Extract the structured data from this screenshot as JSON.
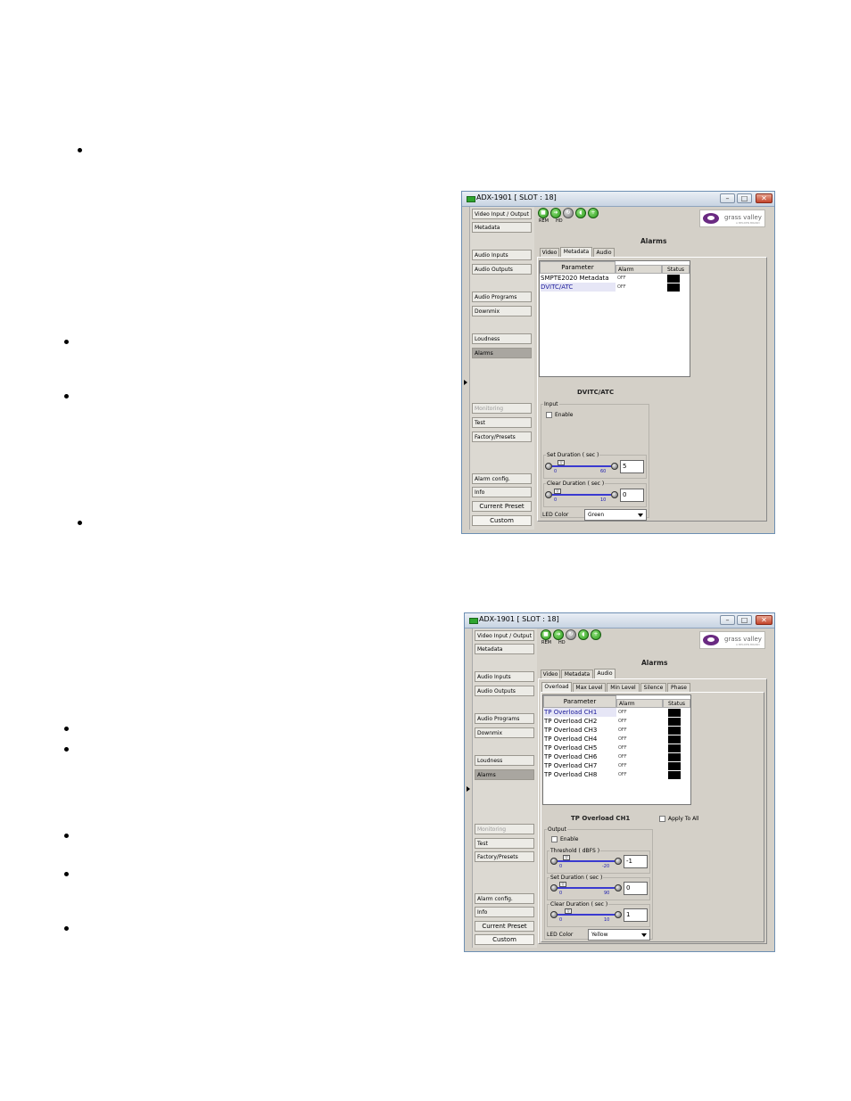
{
  "colors": {
    "title_bar": "#c8d4e2",
    "app_icon": "#2fa52f",
    "status_black": "#000000",
    "logo_purple": "#6a2a82",
    "slider_blue": "#3a3ad0"
  },
  "window1": {
    "title": "ADX-1901 [ SLOT : 18]",
    "win_buttons": {
      "minimize": "–",
      "maximize": "□",
      "close": "✕"
    },
    "toolbar": {
      "rem": "REM",
      "hd": "HD"
    },
    "logo": {
      "name": "grass valley",
      "tagline": "A BELDEN BRAND"
    },
    "nav": [
      "Video Input / Output",
      "Metadata",
      "Audio Inputs",
      "Audio Outputs",
      "Audio Programs",
      "Downmix",
      "Loudness",
      "Alarms",
      "Monitoring",
      "Test",
      "Factory/Presets",
      "Alarm config.",
      "Info"
    ],
    "current_preset": "Current Preset",
    "custom": "Custom",
    "section_title": "Alarms",
    "tabs": [
      "Video",
      "Metadata",
      "Audio"
    ],
    "table": {
      "headers": {
        "parameter": "Parameter",
        "alarm": "Alarm",
        "status": "Status"
      },
      "rows": [
        {
          "name": "SMPTE2020 Metadata",
          "alarm": "OFF"
        },
        {
          "name": "DVITC/ATC",
          "alarm": "OFF"
        }
      ]
    },
    "detail": {
      "title": "DVITC/ATC",
      "input_group": "Input",
      "enable": "Enable",
      "set_duration": {
        "label": "Set Duration ( sec )",
        "min": "0",
        "max": "60",
        "value": "5"
      },
      "clear_duration": {
        "label": "Clear Duration ( sec )",
        "min": "0",
        "max": "10",
        "value": "0"
      },
      "led_color_label": "LED Color",
      "led_color": "Green"
    }
  },
  "window2": {
    "title": "ADX-1901 [ SLOT : 18]",
    "win_buttons": {
      "minimize": "–",
      "maximize": "□",
      "close": "✕"
    },
    "toolbar": {
      "rem": "REM",
      "hd": "HD"
    },
    "logo": {
      "name": "grass valley",
      "tagline": "A BELDEN BRAND"
    },
    "nav": [
      "Video Input / Output",
      "Metadata",
      "Audio Inputs",
      "Audio Outputs",
      "Audio Programs",
      "Downmix",
      "Loudness",
      "Alarms",
      "Monitoring",
      "Test",
      "Factory/Presets",
      "Alarm config.",
      "Info"
    ],
    "current_preset": "Current Preset",
    "custom": "Custom",
    "section_title": "Alarms",
    "tabs": [
      "Video",
      "Metadata",
      "Audio"
    ],
    "subtabs": [
      "Overload",
      "Max Level",
      "Min Level",
      "Silence",
      "Phase"
    ],
    "table": {
      "headers": {
        "parameter": "Parameter",
        "alarm": "Alarm",
        "status": "Status"
      },
      "rows": [
        {
          "name": "TP Overload CH1",
          "alarm": "OFF"
        },
        {
          "name": "TP Overload CH2",
          "alarm": "OFF"
        },
        {
          "name": "TP Overload CH3",
          "alarm": "OFF"
        },
        {
          "name": "TP Overload CH4",
          "alarm": "OFF"
        },
        {
          "name": "TP Overload CH5",
          "alarm": "OFF"
        },
        {
          "name": "TP Overload CH6",
          "alarm": "OFF"
        },
        {
          "name": "TP Overload CH7",
          "alarm": "OFF"
        },
        {
          "name": "TP Overload CH8",
          "alarm": "OFF"
        }
      ]
    },
    "detail": {
      "title": "TP Overload CH1",
      "apply_to_all": "Apply To All",
      "output_group": "Output",
      "enable": "Enable",
      "threshold": {
        "label": "Threshold ( dBFS )",
        "min": "0",
        "max": "-20",
        "value": "-1"
      },
      "set_duration": {
        "label": "Set Duration ( sec )",
        "min": "0",
        "max": "90",
        "value": "0"
      },
      "clear_duration": {
        "label": "Clear Duration ( sec )",
        "min": "0",
        "max": "10",
        "value": "1"
      },
      "led_color_label": "LED Color",
      "led_color": "Yellow"
    }
  }
}
